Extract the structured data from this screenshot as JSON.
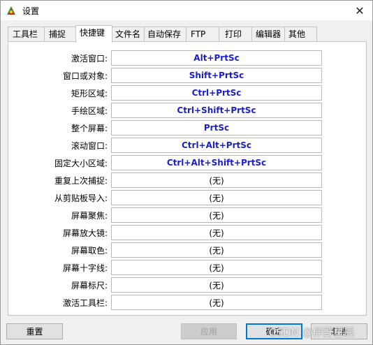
{
  "window": {
    "title": "设置",
    "close_glyph": "✕"
  },
  "tabs": [
    {
      "label": "工具栏"
    },
    {
      "label": "捕捉"
    },
    {
      "label": "快捷键"
    },
    {
      "label": "文件名"
    },
    {
      "label": "自动保存"
    },
    {
      "label": "FTP"
    },
    {
      "label": "打印"
    },
    {
      "label": "编辑器"
    },
    {
      "label": "其他"
    }
  ],
  "hotkeys": [
    {
      "label": "激活窗口:",
      "value": "Alt+PrtSc",
      "set": true
    },
    {
      "label": "窗口或对象:",
      "value": "Shift+PrtSc",
      "set": true
    },
    {
      "label": "矩形区域:",
      "value": "Ctrl+PrtSc",
      "set": true
    },
    {
      "label": "手绘区域:",
      "value": "Ctrl+Shift+PrtSc",
      "set": true
    },
    {
      "label": "整个屏幕:",
      "value": "PrtSc",
      "set": true
    },
    {
      "label": "滚动窗口:",
      "value": "Ctrl+Alt+PrtSc",
      "set": true
    },
    {
      "label": "固定大小区域:",
      "value": "Ctrl+Alt+Shift+PrtSc",
      "set": true
    },
    {
      "label": "重复上次捕捉:",
      "value": "(无)",
      "set": false
    },
    {
      "label": "从剪贴板导入:",
      "value": "(无)",
      "set": false
    },
    {
      "label": "屏幕聚焦:",
      "value": "(无)",
      "set": false
    },
    {
      "label": "屏幕放大镜:",
      "value": "(无)",
      "set": false
    },
    {
      "label": "屏幕取色:",
      "value": "(无)",
      "set": false
    },
    {
      "label": "屏幕十字线:",
      "value": "(无)",
      "set": false
    },
    {
      "label": "屏幕标尺:",
      "value": "(无)",
      "set": false
    },
    {
      "label": "激活工具栏:",
      "value": "(无)",
      "set": false
    }
  ],
  "buttons": {
    "reset": "重置",
    "apply": "应用",
    "ok": "确定",
    "cancel": "取消"
  },
  "watermark": "CSDN @伴野星辰",
  "colors": {
    "hotkey_set": "#1a1fc8",
    "accent": "#0078d7"
  }
}
